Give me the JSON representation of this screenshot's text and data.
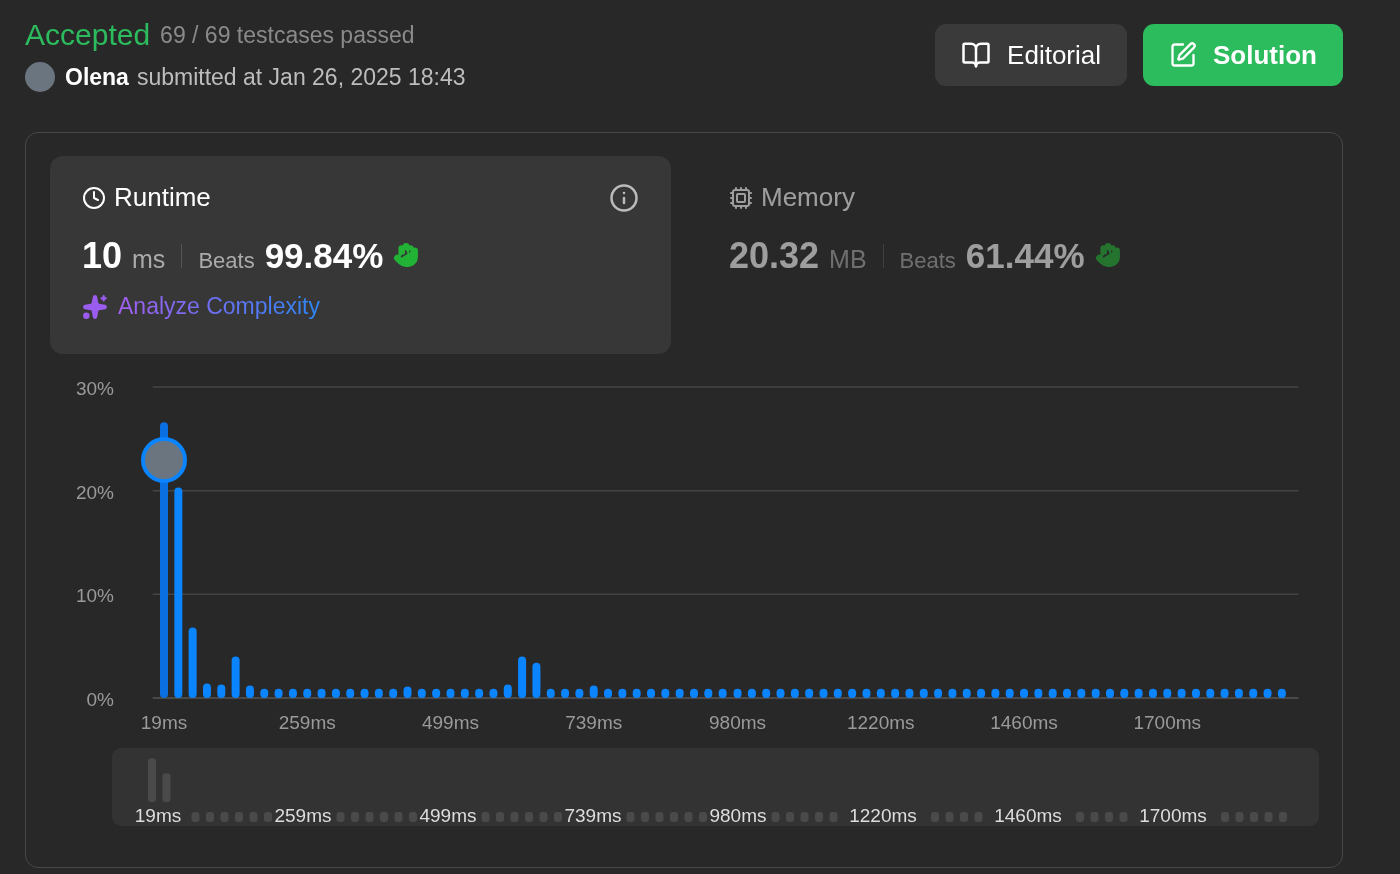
{
  "header": {
    "status": "Accepted",
    "testcases": "69 / 69 testcases passed",
    "user": "Olena",
    "submitted": "submitted at Jan 26, 2025 18:43"
  },
  "buttons": [
    {
      "label": "Editorial",
      "kind": "secondary"
    },
    {
      "label": "Solution",
      "kind": "primary"
    }
  ],
  "metrics": [
    {
      "title": "Runtime",
      "value": "10",
      "unit": "ms",
      "beats_label": "Beats",
      "beats": "99.84%",
      "selected": true,
      "link": "Analyze Complexity"
    },
    {
      "title": "Memory",
      "value": "20.32",
      "unit": "MB",
      "beats_label": "Beats",
      "beats": "61.44%",
      "selected": false
    }
  ],
  "chart_data": {
    "type": "bar",
    "x": [
      19,
      43,
      67,
      91,
      115,
      139,
      163,
      187,
      211,
      235,
      259,
      283,
      307,
      331,
      355,
      379,
      403,
      427,
      451,
      475,
      499,
      523,
      547,
      571,
      595,
      619,
      643,
      667,
      691,
      715,
      739,
      763,
      787,
      811,
      835,
      859,
      883,
      907,
      931,
      955,
      980,
      1004,
      1028,
      1052,
      1076,
      1100,
      1124,
      1148,
      1172,
      1196,
      1220,
      1244,
      1268,
      1292,
      1316,
      1340,
      1364,
      1388,
      1412,
      1436,
      1460,
      1484,
      1508,
      1532,
      1556,
      1580,
      1604,
      1628,
      1652,
      1676,
      1700,
      1724,
      1748,
      1772,
      1796,
      1820,
      1844,
      1868,
      1892
    ],
    "values": [
      26.6,
      20.3,
      6.8,
      1.4,
      1.3,
      4.0,
      1.2,
      0.9,
      0.9,
      0.9,
      0.9,
      0.9,
      0.9,
      0.9,
      0.9,
      0.9,
      0.9,
      1.1,
      0.9,
      0.9,
      0.9,
      0.9,
      0.9,
      0.9,
      1.3,
      4.0,
      3.4,
      0.9,
      0.9,
      0.9,
      1.2,
      0.9,
      0.9,
      0.9,
      0.9,
      0.9,
      0.9,
      0.9,
      0.9,
      0.9,
      0.9,
      0.9,
      0.9,
      0.9,
      0.9,
      0.9,
      0.9,
      0.9,
      0.9,
      0.9,
      0.9,
      0.9,
      0.9,
      0.9,
      0.9,
      0.9,
      0.9,
      0.9,
      0.9,
      0.9,
      0.9,
      0.9,
      0.9,
      0.9,
      0.9,
      0.9,
      0.9,
      0.9,
      0.9,
      0.9,
      0.9,
      0.9,
      0.9,
      0.9,
      0.9,
      0.9,
      0.9,
      0.9,
      0.9
    ],
    "xlim": [
      0,
      1920
    ],
    "ylim": [
      0,
      30
    ],
    "yticks": [
      {
        "value": 0,
        "label": "0%"
      },
      {
        "value": 10,
        "label": "10%"
      },
      {
        "value": 20,
        "label": "20%"
      },
      {
        "value": 30,
        "label": "30%"
      }
    ],
    "xticks": [
      {
        "value": 19,
        "label": "19ms"
      },
      {
        "value": 259,
        "label": "259ms"
      },
      {
        "value": 499,
        "label": "499ms"
      },
      {
        "value": 739,
        "label": "739ms"
      },
      {
        "value": 980,
        "label": "980ms"
      },
      {
        "value": 1220,
        "label": "1220ms"
      },
      {
        "value": 1460,
        "label": "1460ms"
      },
      {
        "value": 1700,
        "label": "1700ms"
      }
    ]
  },
  "overview": {
    "labels": [
      "19ms",
      "259ms",
      "499ms",
      "739ms",
      "980ms",
      "1220ms",
      "1460ms",
      "1700ms"
    ]
  }
}
